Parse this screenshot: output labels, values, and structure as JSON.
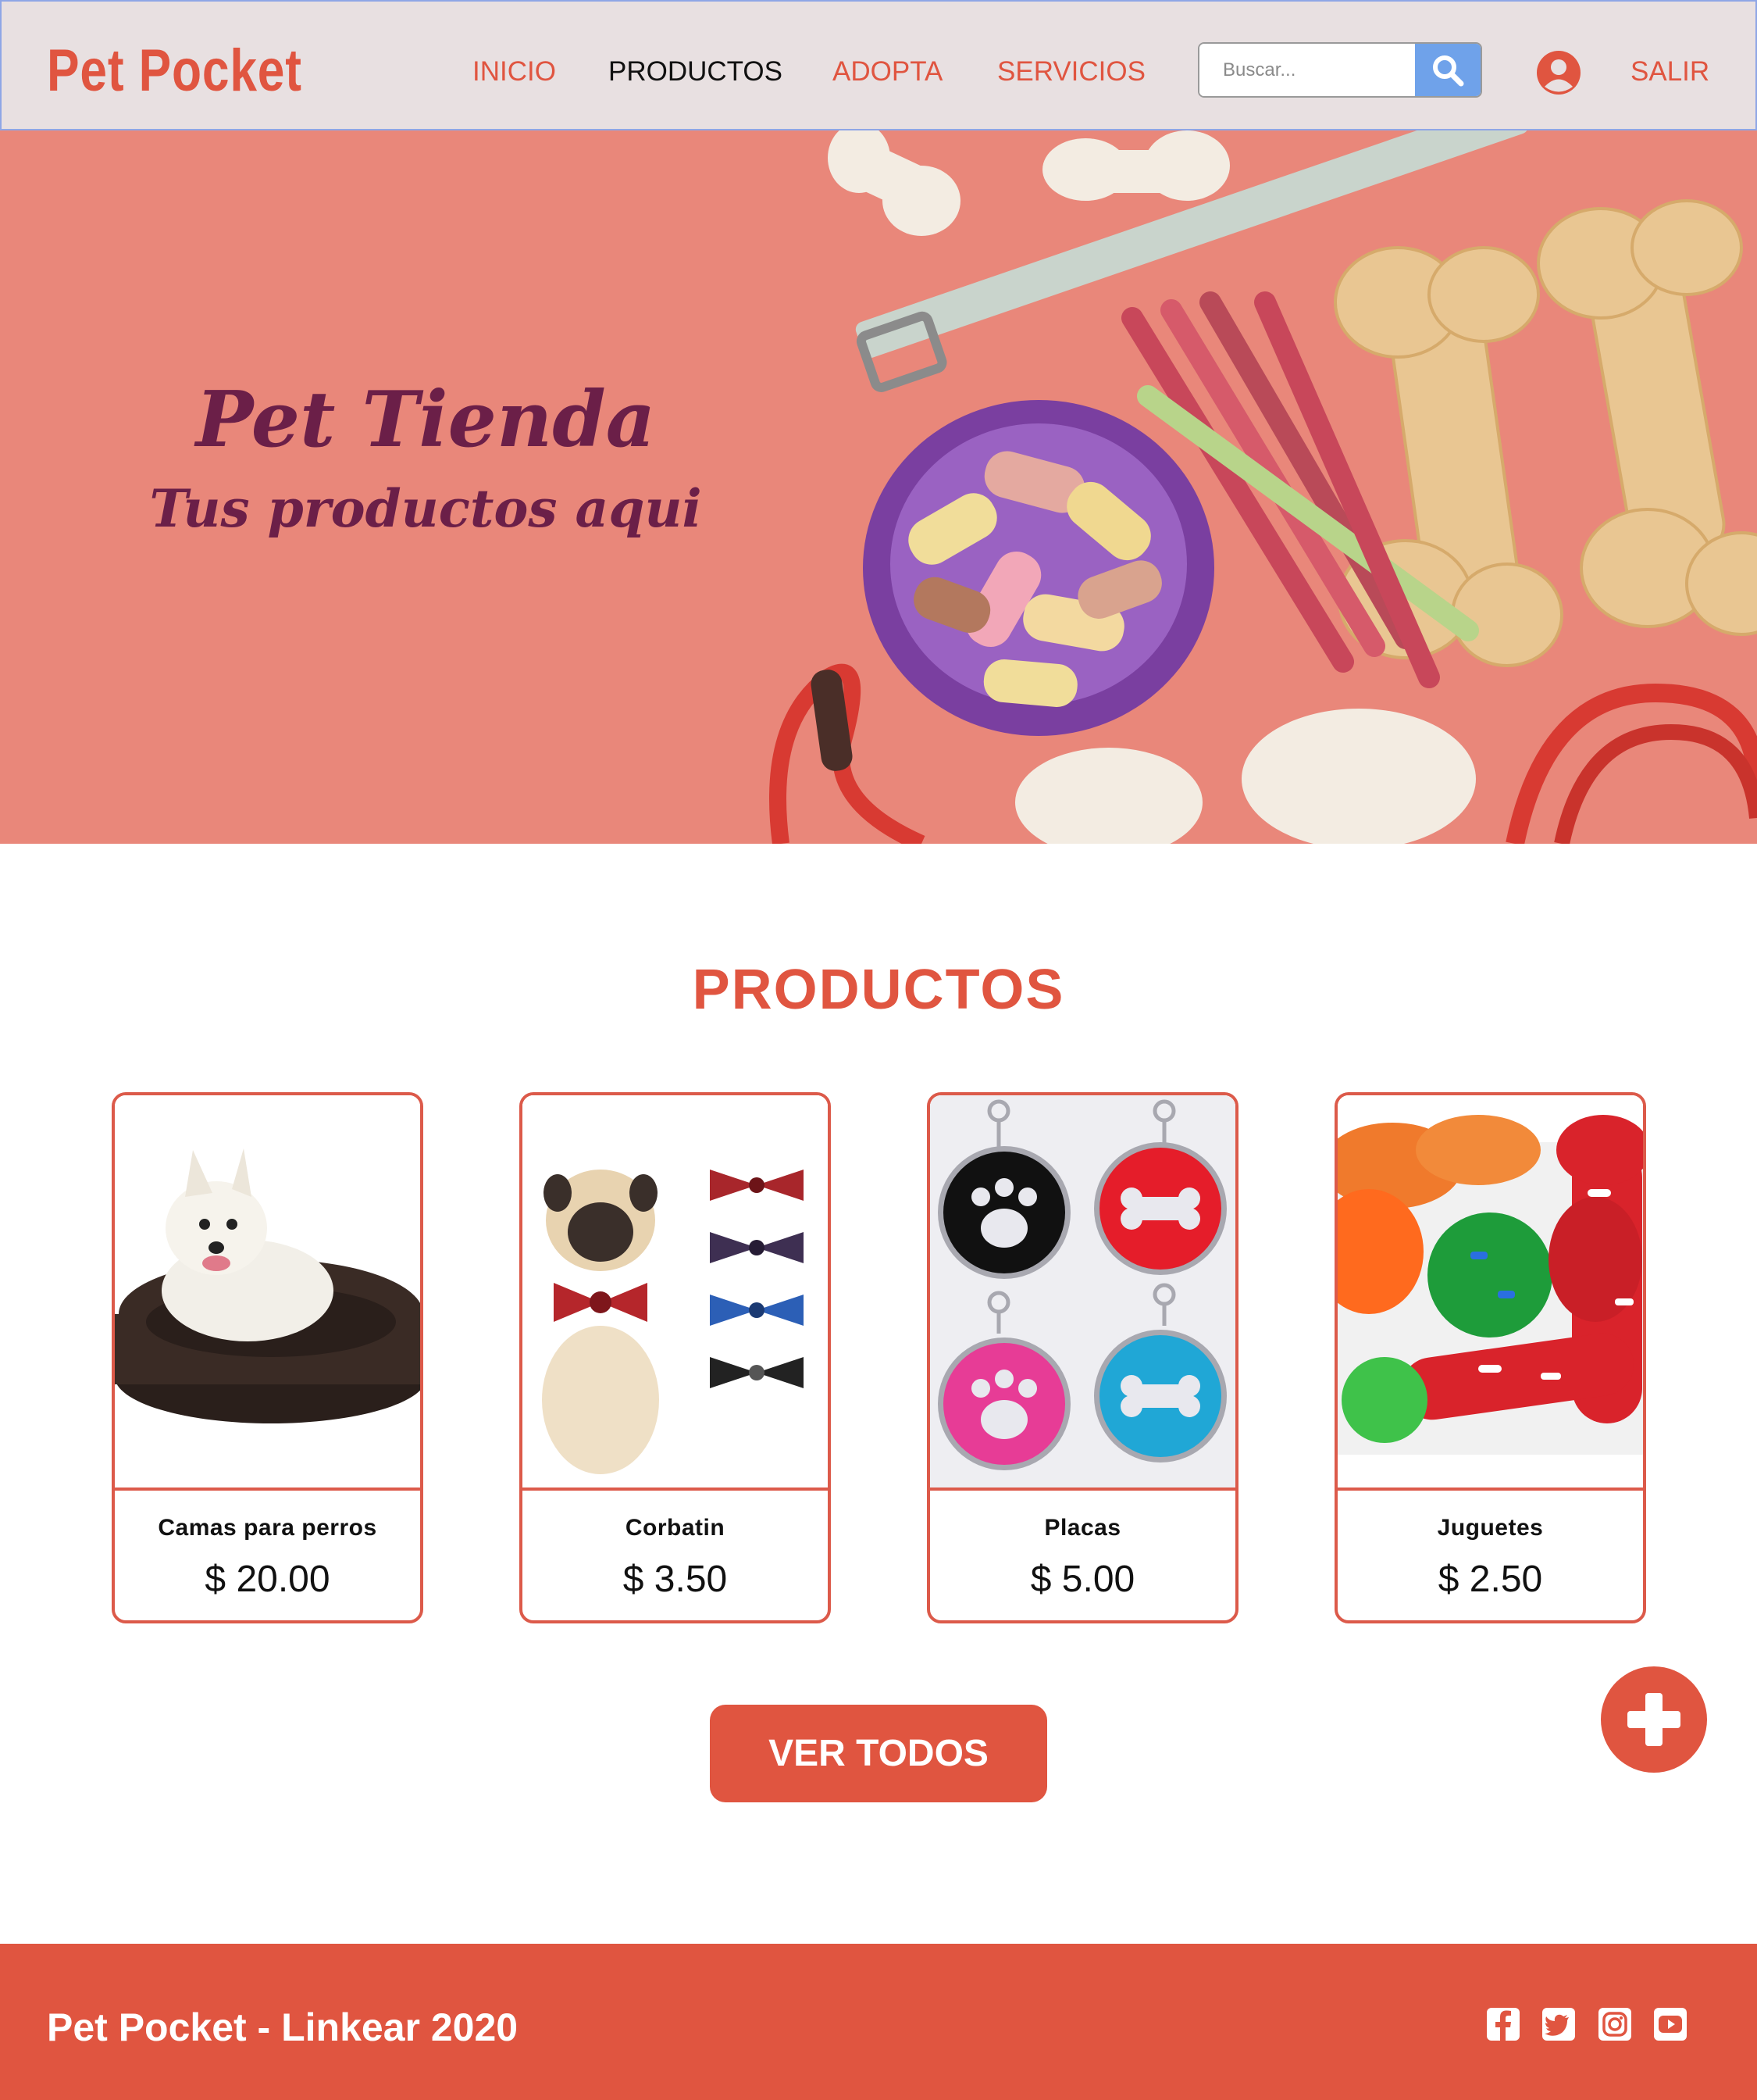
{
  "navbar": {
    "brand": "Pet Pocket",
    "links": [
      {
        "label": "INICIO",
        "active": false
      },
      {
        "label": "PRODUCTOS",
        "active": true
      },
      {
        "label": "ADOPTA",
        "active": false
      },
      {
        "label": "SERVICIOS",
        "active": false
      }
    ],
    "search_placeholder": "Buscar...",
    "logout": "SALIR"
  },
  "hero": {
    "title": "Pet Tienda",
    "subtitle": "Tus productos aqui"
  },
  "products": {
    "title": "PRODUCTOS",
    "items": [
      {
        "name": "Camas para perros",
        "price": "$ 20.00",
        "image": "dog-bed-photo"
      },
      {
        "name": "Corbatin",
        "price": "$ 3.50",
        "image": "bow-tie-photo"
      },
      {
        "name": "Placas",
        "price": "$ 5.00",
        "image": "pet-tags-photo"
      },
      {
        "name": "Juguetes",
        "price": "$ 2.50",
        "image": "dog-toys-photo"
      }
    ],
    "view_all": "VER TODOS"
  },
  "fab": {
    "icon": "plus-icon"
  },
  "footer": {
    "text": "Pet Pocket - Linkear 2020",
    "social": [
      "facebook-icon",
      "twitter-icon",
      "instagram-icon",
      "youtube-icon"
    ]
  },
  "colors": {
    "accent": "#e05540",
    "navbar_bg": "#e8e0e1",
    "hero_bg": "#e9877a",
    "hero_text": "#6b1f48",
    "search_button": "#6fa2ea"
  }
}
